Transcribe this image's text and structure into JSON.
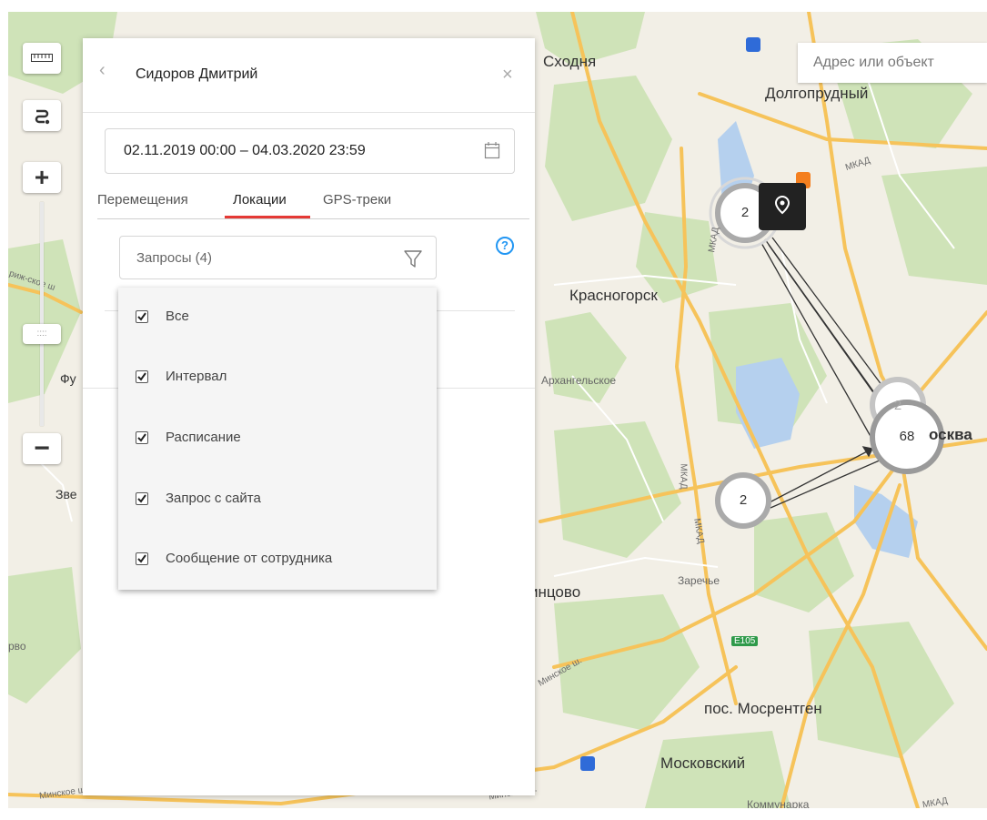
{
  "search": {
    "placeholder": "Адрес или объект"
  },
  "map_controls": {
    "ruler_icon": "ruler-icon",
    "route_icon": "route-icon",
    "zoom_in_label": "+",
    "zoom_out_label": "−",
    "zoom_thumb_label": "::::"
  },
  "map": {
    "labels": [
      "Сходня",
      "Долгопрудный",
      "Красногорск",
      "Архангельское",
      "Заречье",
      "пос. Мосрентген",
      "Московский",
      "Коммунарка",
      "инцово",
      "осква",
      "Зве",
      "Фу",
      "рво"
    ],
    "roads": [
      "МКАД",
      "МКАД",
      "МКАД",
      "МКАД",
      "Минское ш.",
      "Минское ш.",
      "Минское ш.",
      "риж-ское ш",
      "E105",
      "МКАД"
    ],
    "clusters": [
      {
        "count": "2"
      },
      {
        "count": "2"
      },
      {
        "count": "68"
      },
      {
        "count": "2"
      }
    ]
  },
  "panel": {
    "title": "Сидоров Дмитрий",
    "date_range": "02.11.2019 00:00 – 04.03.2020 23:59",
    "tabs": [
      {
        "label": "Перемещения",
        "active": false
      },
      {
        "label": "Локации",
        "active": true
      },
      {
        "label": "GPS-треки",
        "active": false
      }
    ],
    "filter": {
      "label": "Запросы (4)",
      "help": "?",
      "options": [
        {
          "label": "Все",
          "checked": true
        },
        {
          "label": "Интервал",
          "checked": true
        },
        {
          "label": "Расписание",
          "checked": true
        },
        {
          "label": "Запрос с сайта",
          "checked": true
        },
        {
          "label": "Сообщение от сотрудника",
          "checked": true
        }
      ]
    }
  },
  "colors": {
    "accent_red": "#e53935",
    "help_blue": "#2196f3",
    "road_yellow": "#f6c35a",
    "park_green": "#cfe3b8",
    "water_blue": "#b5d0ee"
  }
}
